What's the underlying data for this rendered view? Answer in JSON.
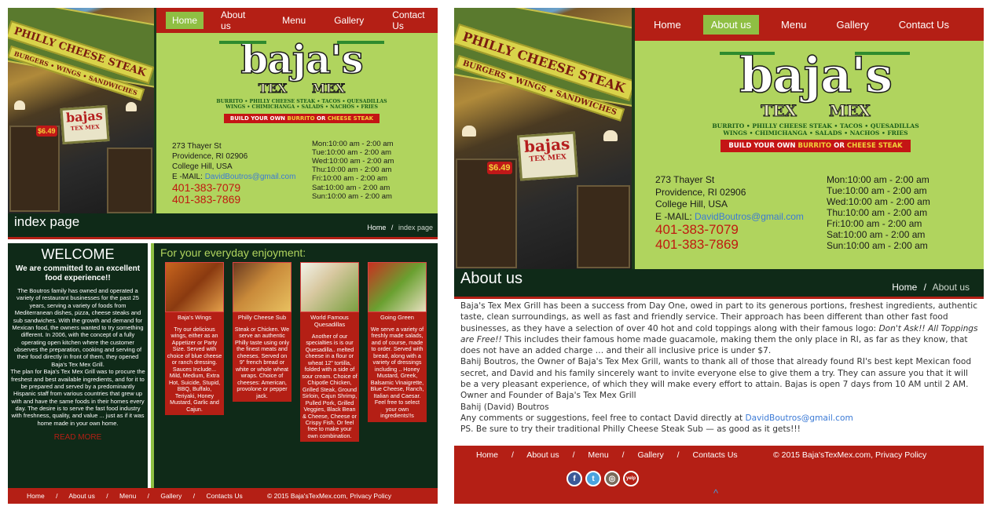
{
  "nav": [
    "Home",
    "About us",
    "Menu",
    "Gallery",
    "Contact Us"
  ],
  "logo": {
    "name": "baja's",
    "tex_mex": "TEX MEX",
    "tagline1": "BURRITO • PHILLY CHEESE STEAK • TACOS • QUESADILLAS",
    "tagline2": "WINGS • CHIMICHANGA • SALADS • NACHOS • FRIES",
    "build_a": "BUILD YOUR OWN ",
    "build_b": "BURRITO",
    "build_c": " OR ",
    "build_d": "CHEESE STEAK"
  },
  "storefront": {
    "sign_text": "PHILLY CHEESE STEAK",
    "sign_sub": "BURGERS • WINGS • SANDWICHES",
    "baja_sign": "bajas",
    "baja_sub": "TEX MEX",
    "price": "$6.49"
  },
  "address": {
    "street": "273 Thayer St",
    "city": "Providence, RI 02906",
    "area": "College Hill, USA",
    "email_label": "E -MAIL: ",
    "email": "DavidBoutros@gmail.com",
    "phone1": "401-383-7079",
    "phone2": "401-383-7869"
  },
  "hours": [
    "Mon:10:00 am - 2:00 am",
    "Tue:10:00 am - 2:00 am",
    "Wed:10:00 am - 2:00 am",
    "Thu:10:00 am - 2:00 am",
    "Fri:10:00 am - 2:00 am",
    "Sat:10:00 am - 2:00 am",
    "Sun:10:00 am - 2:00 am"
  ],
  "left": {
    "page_title": "index page",
    "crumb_home": "Home",
    "crumb_sep": "/",
    "crumb_current": "index page",
    "welcome_heading": "WELCOME",
    "welcome_sub": "We are committed to an excellent food experience!!",
    "welcome_body": "The Boutros family has owned and operated a variety of restaurant businesses for the past 25 years, serving a variety of foods from Mediterranean dishes, pizza, cheese steaks and sub sandwiches. With the growth and demand for Mexican food, the owners wanted to try something different. In 2006, with the concept of a fully operating open kitchen where the customer observes the preparation, cooking and serving of their food directly in front of them, they opened Baja's Tex Mex Grill.",
    "welcome_body2": "The plan for Baja's Tex Mex Grill was to procure the freshest and best available ingredients, and for it to be prepared and served by a predominantly Hispanic staff from various countries that grew up with and have the same foods in their homes every day. The desire is to serve the fast food industry with freshness, quality, and value ... just as if it was home made in your own home.",
    "read_more": "READ MORE",
    "enjoy_heading": "For your everyday enjoyment:",
    "cards": [
      {
        "title": "Baja's Wings",
        "text": "Try our delicious wings, either as an Appetizer or Party Size. Served with choice of blue cheese or ranch dressing. Sauces Include... Mild, Medium, Extra Hot, Suicide, Stupid, BBQ, Buffalo, Teriyaki, Honey Mustard, Garlic and Cajun."
      },
      {
        "title": "Philly Cheese Sub",
        "text": "Steak or Chicken. We serve an authentic Philly taste using only the finest meats and cheeses. Served on 9\" french bread or white or whole wheat wraps. Choice of cheeses: American, provolone or pepper jack."
      },
      {
        "title": "World Famous Quesadillas",
        "text": "Another of our specialties is is our Quesadilla.. melted cheese in a flour or wheat 12\" tortilla, folded with a side of sour cream. Choice of Chipotle Chicken, Grilled Steak, Ground Sirloin, Cajun Shrimp, Pulled Pork, Grilled Veggies, Black Bean & Cheese, Cheese or Crispy Fish. Or feel free to make your own combination."
      },
      {
        "title": "Going Green",
        "text": "We serve a variety of freshly made salads, and of course, made to order. Served with bread, along with a variety of dressings including .. Honey Mustard, Greek, Balsamic Vinaigrette, Blue Cheese, Ranch, Italian and Caesar. Feel free to select your own ingredients!!s"
      }
    ],
    "footer_links": [
      "Home",
      "About us",
      "Menu",
      "Gallery",
      "Contacts Us"
    ],
    "footer_sep": "/",
    "copyright": "© 2015 Baja'sTexMex.com, Privacy Policy"
  },
  "right": {
    "page_title": "About us",
    "crumb_home": "Home",
    "crumb_sep": "/",
    "crumb_current": "About us",
    "p1a": "Baja's Tex Mex Grill has been a success from Day One, owed in part to its generous portions, freshest ingredients, authentic taste, clean surroundings, as well as fast and friendly service. Their approach has been different than other fast food businesses, as they have a selection of over 40 hot and cold toppings along with their famous logo:",
    "p1b": "Don't Ask!! All Toppings are Free!!",
    "p1c": "This includes their famous home made guacamole, making them the only place in RI, as far as they know, that does not have an added charge … and their all inclusive price is under $7.",
    "p2": "Bahij Boutros, the Owner of Baja's Tex Mex Grill, wants to thank all of those that already found RI's best kept Mexican food secret, and David and his family sincerely want to invite everyone else to give them a try. They can assure you that it will be a very pleasant experience, of which they will make every effort to attain. Bajas is open 7 days from 10 AM until 2 AM.",
    "p3": "Owner and Founder of Baja's Tex Mex Grill",
    "p4": "Bahij (David) Boutros",
    "p5a": "Any comments or suggestions, feel free to contact David directly at ",
    "p5b": "DavidBoutros@gmail.com",
    "p6": "PS. Be sure to try their traditional Philly Cheese Steak Sub — as good as it gets!!!",
    "footer_links": [
      "Home",
      "About us",
      "Menu",
      "Gallery",
      "Contacts Us"
    ],
    "footer_sep": "/",
    "copyright": "© 2015 Baja'sTexMex.com, Privacy Policy",
    "social": [
      "f",
      "t",
      "◎",
      "yelp"
    ],
    "scroll_top": "^"
  },
  "colors": {
    "nav_red": "#b41f15",
    "lime": "#b0d45e",
    "active_green": "#8fbf43",
    "dark_green": "#0f2a18",
    "link_blue": "#3b7ad6"
  }
}
